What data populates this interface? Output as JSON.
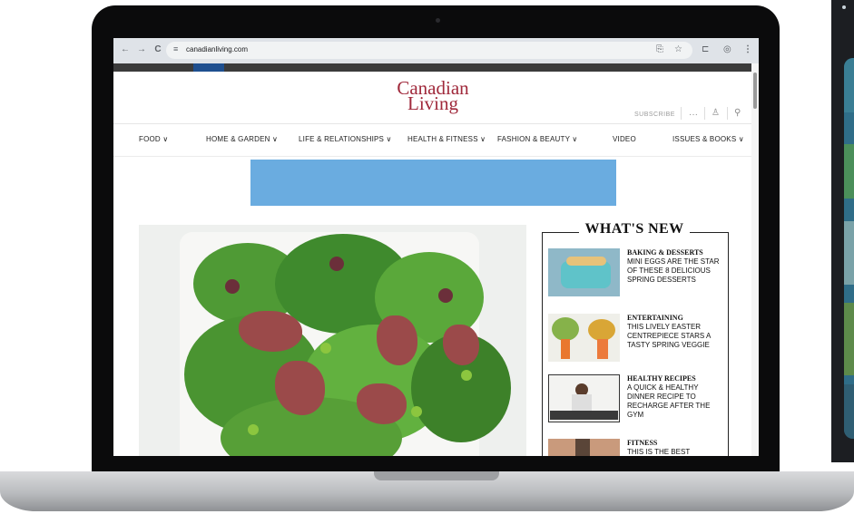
{
  "browser": {
    "url": "canadianliving.com",
    "back_glyph": "←",
    "forward_glyph": "→",
    "reload_glyph": "C",
    "site_info_glyph": "≡",
    "translate_glyph": "⎘",
    "bookmark_glyph": "☆",
    "extensions_glyph": "⊏",
    "profile_glyph": "◎",
    "menu_glyph": "⋮"
  },
  "page": {
    "brand_line1": "Canadian",
    "brand_line2": "Living",
    "subscribe": "SUBSCRIBE",
    "more_glyph": "···",
    "account_glyph": "♙",
    "search_glyph": "⚲",
    "nav": [
      {
        "label": "FOOD ∨"
      },
      {
        "label": "HOME & GARDEN ∨"
      },
      {
        "label": "LIFE & RELATIONSHIPS ∨"
      },
      {
        "label": "HEALTH & FITNESS ∨"
      },
      {
        "label": "FASHION & BEAUTY ∨"
      },
      {
        "label": "VIDEO"
      },
      {
        "label": "ISSUES & BOOKS ∨"
      }
    ]
  },
  "whats_new": {
    "title": "WHAT'S NEW",
    "stories": [
      {
        "category": "BAKING & DESSERTS",
        "headline": "MINI EGGS ARE THE STAR OF THESE 8 DELICIOUS SPRING DESSERTS"
      },
      {
        "category": "ENTERTAINING",
        "headline": "THIS LIVELY EASTER CENTREPIECE STARS A TASTY SPRING VEGGIE"
      },
      {
        "category": "HEALTHY RECIPES",
        "headline": "A QUICK & HEALTHY DINNER RECIPE TO RECHARGE AFTER THE GYM"
      },
      {
        "category": "FITNESS",
        "headline": "THIS IS THE BEST"
      }
    ]
  },
  "colors": {
    "brand": "#a0293b",
    "ad_placeholder": "#6aace0"
  }
}
